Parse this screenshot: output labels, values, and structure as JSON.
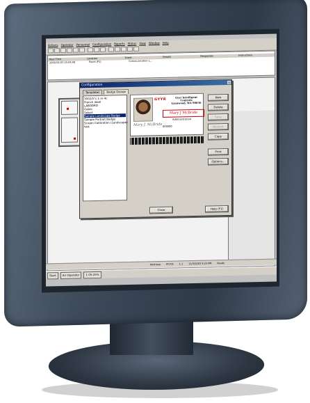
{
  "app": {
    "menu": [
      "Actions",
      "Operator",
      "Personnel",
      "Configuration",
      "Reports",
      "Status",
      "View",
      "Window",
      "Help"
    ],
    "events_header": [
      "Real Time",
      "Location",
      "Event",
      "Details",
      "Responses",
      "Instructions"
    ],
    "events_row": [
      "2004-04-03 15:04:08",
      "Panel (P1)",
      "Communication L...",
      "",
      "",
      ""
    ],
    "statusbar": [
      "Nortrase",
      "PO7/6",
      "1.1",
      "11/3/2003 9:25 PM",
      "Ready"
    ],
    "taskbar": {
      "start": "Start",
      "tasks": [
        "Air Operator",
        "1   05:25%"
      ]
    }
  },
  "dialog": {
    "title": "Configuration",
    "tabs": [
      "Templates",
      "Badge Design"
    ],
    "list_items": [
      "3002/5°c.1 m-4c",
      "French label",
      "LABODRO",
      "Gates",
      "Select",
      "Sample Landscape Badge",
      "Sample Portrait Badge",
      "Screen Calibration (Landscape)",
      "test"
    ],
    "selected_index": 5,
    "side_buttons": [
      "New",
      "Delete",
      "Save",
      "Restore",
      "Copy",
      "Print",
      "Options..."
    ],
    "disabled_buttons": [
      "Save",
      "Restore"
    ],
    "bottom_buttons": [
      "Close",
      "Help (F1)"
    ],
    "badge": {
      "logo": "GYYR",
      "company": "Gyyr Intelligent Controls\nLynnwood, WA 98036",
      "name": "Mary J McBride",
      "role": "Administration",
      "signature": "Mary J. McBride",
      "number": "000000"
    }
  }
}
